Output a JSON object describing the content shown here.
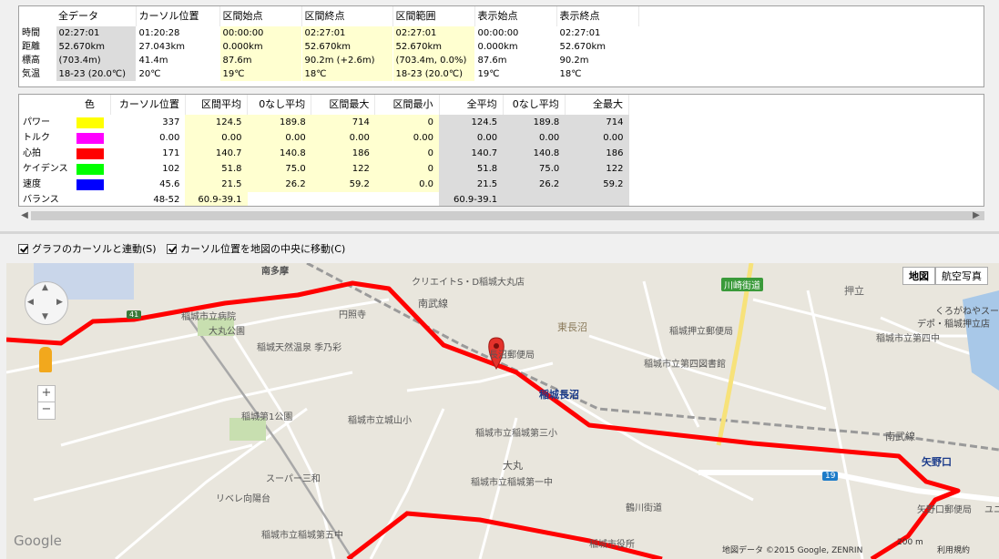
{
  "summary": {
    "headers": [
      "全データ",
      "カーソル位置",
      "区間始点",
      "区間終点",
      "区間範囲",
      "表示始点",
      "表示終点"
    ],
    "rows": [
      {
        "label": "時間",
        "values": [
          "02:27:01",
          "01:20:28",
          "00:00:00",
          "02:27:01",
          "02:27:01",
          "00:00:00",
          "02:27:01"
        ]
      },
      {
        "label": "距離",
        "values": [
          "52.670km",
          "27.043km",
          "0.000km",
          "52.670km",
          "52.670km",
          "0.000km",
          "52.670km"
        ]
      },
      {
        "label": "標高",
        "values": [
          "(703.4m)",
          "41.4m",
          "87.6m",
          "90.2m (+2.6m)",
          "(703.4m, 0.0%)",
          "87.6m",
          "90.2m"
        ]
      },
      {
        "label": "気温",
        "values": [
          "18-23 (20.0℃)",
          "20℃",
          "19℃",
          "18℃",
          "18-23 (20.0℃)",
          "19℃",
          "18℃"
        ]
      }
    ]
  },
  "stats": {
    "headers": [
      "色",
      "カーソル位置",
      "区間平均",
      "0なし平均",
      "区間最大",
      "区間最小",
      "全平均",
      "0なし平均",
      "全最大"
    ],
    "rows": [
      {
        "label": "パワー",
        "color": "#ffff00",
        "values": [
          "337",
          "124.5",
          "189.8",
          "714",
          "0",
          "124.5",
          "189.8",
          "714"
        ]
      },
      {
        "label": "トルク",
        "color": "#ff00ff",
        "values": [
          "0.00",
          "0.00",
          "0.00",
          "0.00",
          "0.00",
          "0.00",
          "0.00",
          "0.00"
        ]
      },
      {
        "label": "心拍",
        "color": "#ff0000",
        "values": [
          "171",
          "140.7",
          "140.8",
          "186",
          "0",
          "140.7",
          "140.8",
          "186"
        ]
      },
      {
        "label": "ケイデンス",
        "color": "#00ff00",
        "values": [
          "102",
          "51.8",
          "75.0",
          "122",
          "0",
          "51.8",
          "75.0",
          "122"
        ]
      },
      {
        "label": "速度",
        "color": "#0000ff",
        "values": [
          "45.6",
          "21.5",
          "26.2",
          "59.2",
          "0.0",
          "21.5",
          "26.2",
          "59.2"
        ]
      },
      {
        "label": "バランス",
        "color": "",
        "values": [
          "48-52",
          "60.9-39.1",
          "",
          "",
          "",
          "60.9-39.1",
          "",
          ""
        ]
      }
    ]
  },
  "options": {
    "link_cursor": "グラフのカーソルと連動(S)",
    "center_map": "カーソル位置を地図の中央に移動(C)"
  },
  "map": {
    "type_map": "地図",
    "type_satellite": "航空写真",
    "zoom_in": "+",
    "zoom_out": "−",
    "route_color": "#ff0000",
    "labels": [
      {
        "id": "minamitama",
        "text": "南多摩"
      },
      {
        "id": "create",
        "text": "クリエイトS・D稲城大丸店"
      },
      {
        "id": "kawasaki",
        "text": "川崎街道"
      },
      {
        "id": "oshitate",
        "text": "押立"
      },
      {
        "id": "kuronegaya",
        "text": "くろがねやスーパー"
      },
      {
        "id": "depot",
        "text": "デポ・稲城押立店"
      },
      {
        "id": "hospital",
        "text": "稲城市立病院"
      },
      {
        "id": "enshoji",
        "text": "円照寺"
      },
      {
        "id": "nanbusen1",
        "text": "南武線"
      },
      {
        "id": "higashinagasaka",
        "text": "東長沼"
      },
      {
        "id": "oshitatepost",
        "text": "稲城押立郵便局"
      },
      {
        "id": "nagasakapost",
        "text": "長沼郵便局"
      },
      {
        "id": "daimarupark",
        "text": "大丸公園"
      },
      {
        "id": "onsen",
        "text": "稲城天然温泉 季乃彩"
      },
      {
        "id": "library",
        "text": "稲城市立第四図書館"
      },
      {
        "id": "inagi4",
        "text": "稲城市立第四中"
      },
      {
        "id": "inaginaganuma",
        "text": "稲城長沼"
      },
      {
        "id": "inagi1park",
        "text": "稲城第1公園"
      },
      {
        "id": "yamanoshou",
        "text": "稲城市立城山小"
      },
      {
        "id": "dai3sho",
        "text": "稲城市立稲城第三小"
      },
      {
        "id": "nanbusen2",
        "text": "南武線"
      },
      {
        "id": "yanokuchi",
        "text": "矢野口"
      },
      {
        "id": "daimaru",
        "text": "大丸"
      },
      {
        "id": "dai1chu",
        "text": "稲城市立稲城第一中"
      },
      {
        "id": "supermiwa",
        "text": "スーパー三和"
      },
      {
        "id": "riveru",
        "text": "リベレ向陽台"
      },
      {
        "id": "tsurukawa",
        "text": "鶴川街道"
      },
      {
        "id": "yanokuchipost",
        "text": "矢野口郵便局"
      },
      {
        "id": "dai5chu",
        "text": "稲城市立稲城第五中"
      },
      {
        "id": "cityhall",
        "text": "稲城市役所"
      },
      {
        "id": "route19",
        "text": "19"
      },
      {
        "id": "route41",
        "text": "41"
      },
      {
        "id": "google",
        "text": "Google"
      },
      {
        "id": "copyright",
        "text": "地図データ ©2015 Google, ZENRIN"
      },
      {
        "id": "scale",
        "text": "200 m"
      },
      {
        "id": "terms",
        "text": "利用規約"
      },
      {
        "id": "yuni",
        "text": "ユニ"
      }
    ]
  }
}
